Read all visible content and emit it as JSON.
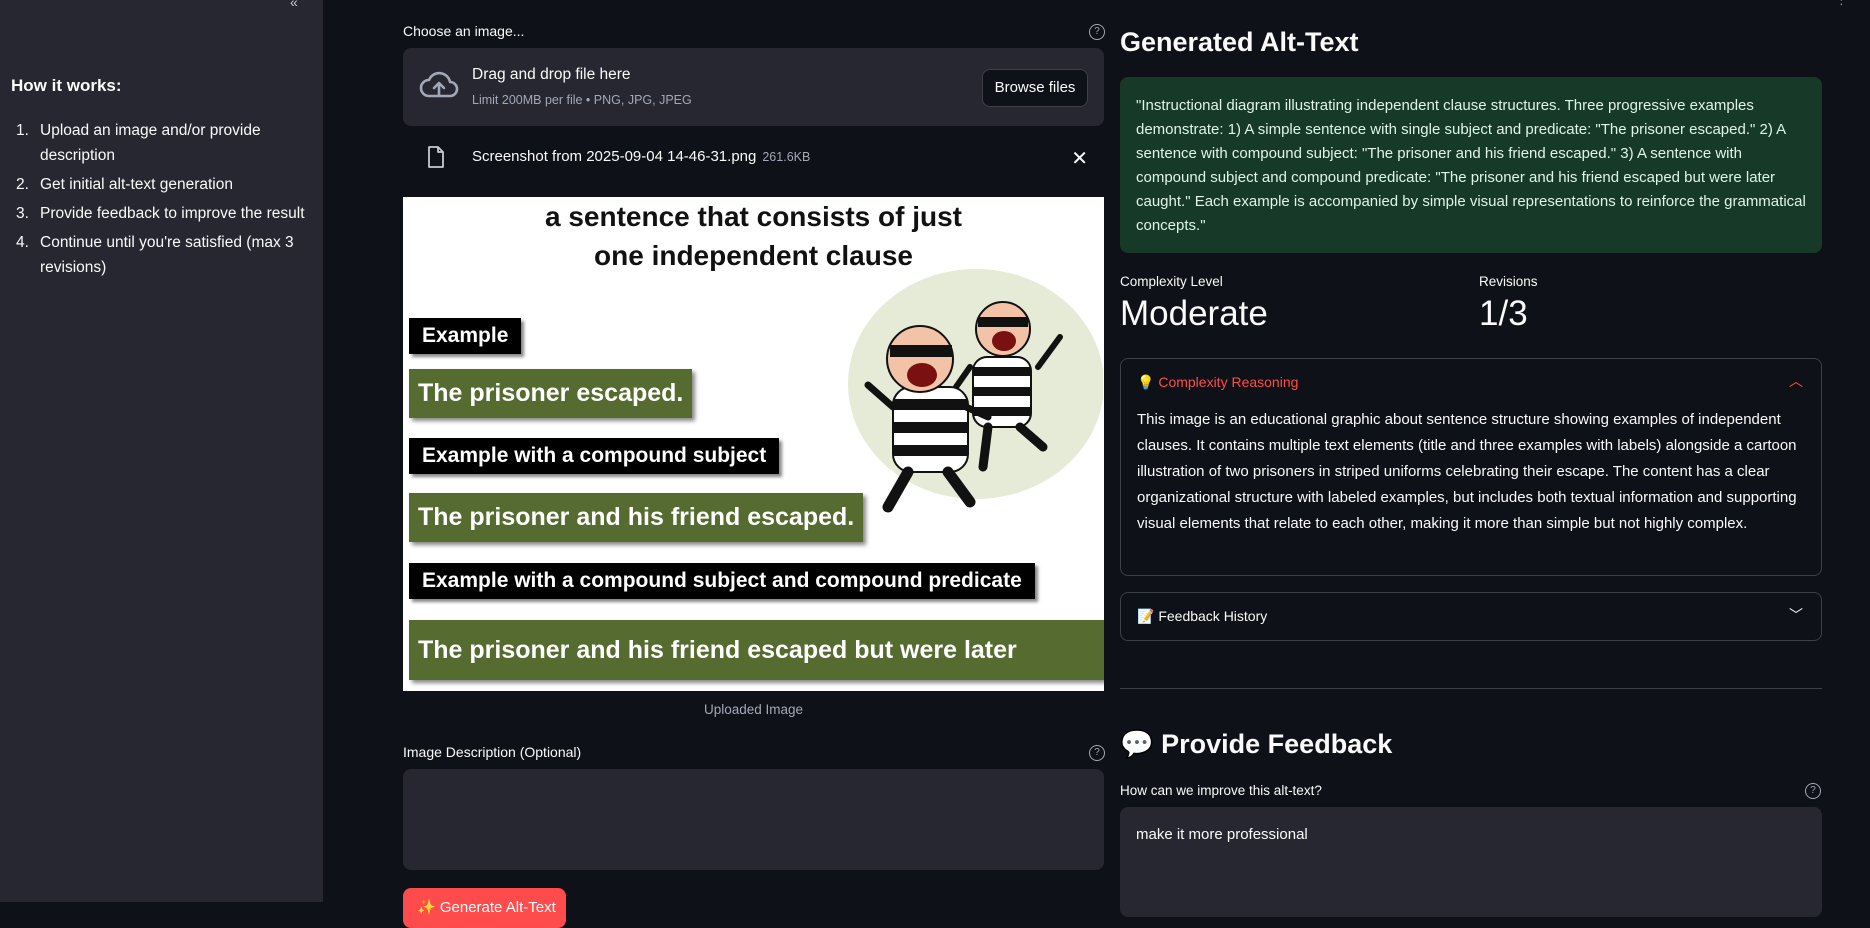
{
  "sidebar": {
    "collapse_glyph": "«",
    "title": "How it works:",
    "steps": [
      {
        "num": "1.",
        "text": "Upload an image and/or provide description"
      },
      {
        "num": "2.",
        "text": "Get initial alt-text generation"
      },
      {
        "num": "3.",
        "text": "Provide feedback to improve the result"
      },
      {
        "num": "4.",
        "text": "Continue until you're satisfied (max 3 revisions)"
      }
    ]
  },
  "uploader": {
    "label": "Choose an image...",
    "drag_text": "Drag and drop file here",
    "limit_text": "Limit 200MB per file • PNG, JPG, JPEG",
    "browse_label": "Browse files",
    "file_name": "Screenshot from 2025-09-04 14-46-31.png",
    "file_size": "261.6KB"
  },
  "preview": {
    "title_line1": "a sentence that consists of just",
    "title_line2": "one independent clause",
    "label1": "Example",
    "sentence1": "The prisoner escaped.",
    "label2": "Example with a compound subject",
    "sentence2": "The prisoner and his friend escaped.",
    "label3": "Example with a compound subject and compound predicate",
    "sentence3": "The prisoner and his friend escaped but were later caught.",
    "caption": "Uploaded Image"
  },
  "description": {
    "label": "Image Description (Optional)",
    "value": ""
  },
  "generate_button": {
    "label": "✨ Generate Alt-Text"
  },
  "result": {
    "heading": "Generated Alt-Text",
    "alt_text": "\"Instructional diagram illustrating independent clause structures. Three progressive examples demonstrate: 1) A simple sentence with single subject and predicate: \"The prisoner escaped.\" 2) A sentence with compound subject: \"The prisoner and his friend escaped.\" 3) A sentence with compound subject and compound predicate: \"The prisoner and his friend escaped but were later caught.\" Each example is accompanied by simple visual representations to reinforce the grammatical concepts.\"",
    "complexity_label": "Complexity Level",
    "complexity_value": "Moderate",
    "revisions_label": "Revisions",
    "revisions_value": "1/3"
  },
  "reasoning": {
    "icon": "💡",
    "title": "Complexity Reasoning",
    "body": "This image is an educational graphic about sentence structure showing examples of independent clauses. It contains multiple text elements (title and three examples with labels) alongside a cartoon illustration of two prisoners in striped uniforms celebrating their escape. The content has a clear organizational structure with labeled examples, but includes both textual information and supporting visual elements that relate to each other, making it more than simple but not highly complex."
  },
  "history": {
    "icon": "📝",
    "title": "Feedback History"
  },
  "feedback": {
    "icon": "💬",
    "heading": "Provide Feedback",
    "label": "How can we improve this alt-text?",
    "value": "make it more professional"
  },
  "colors": {
    "accent": "#ff4b4b",
    "success_bg": "#173928",
    "sidebar": "#262730",
    "background": "#0e1117"
  }
}
